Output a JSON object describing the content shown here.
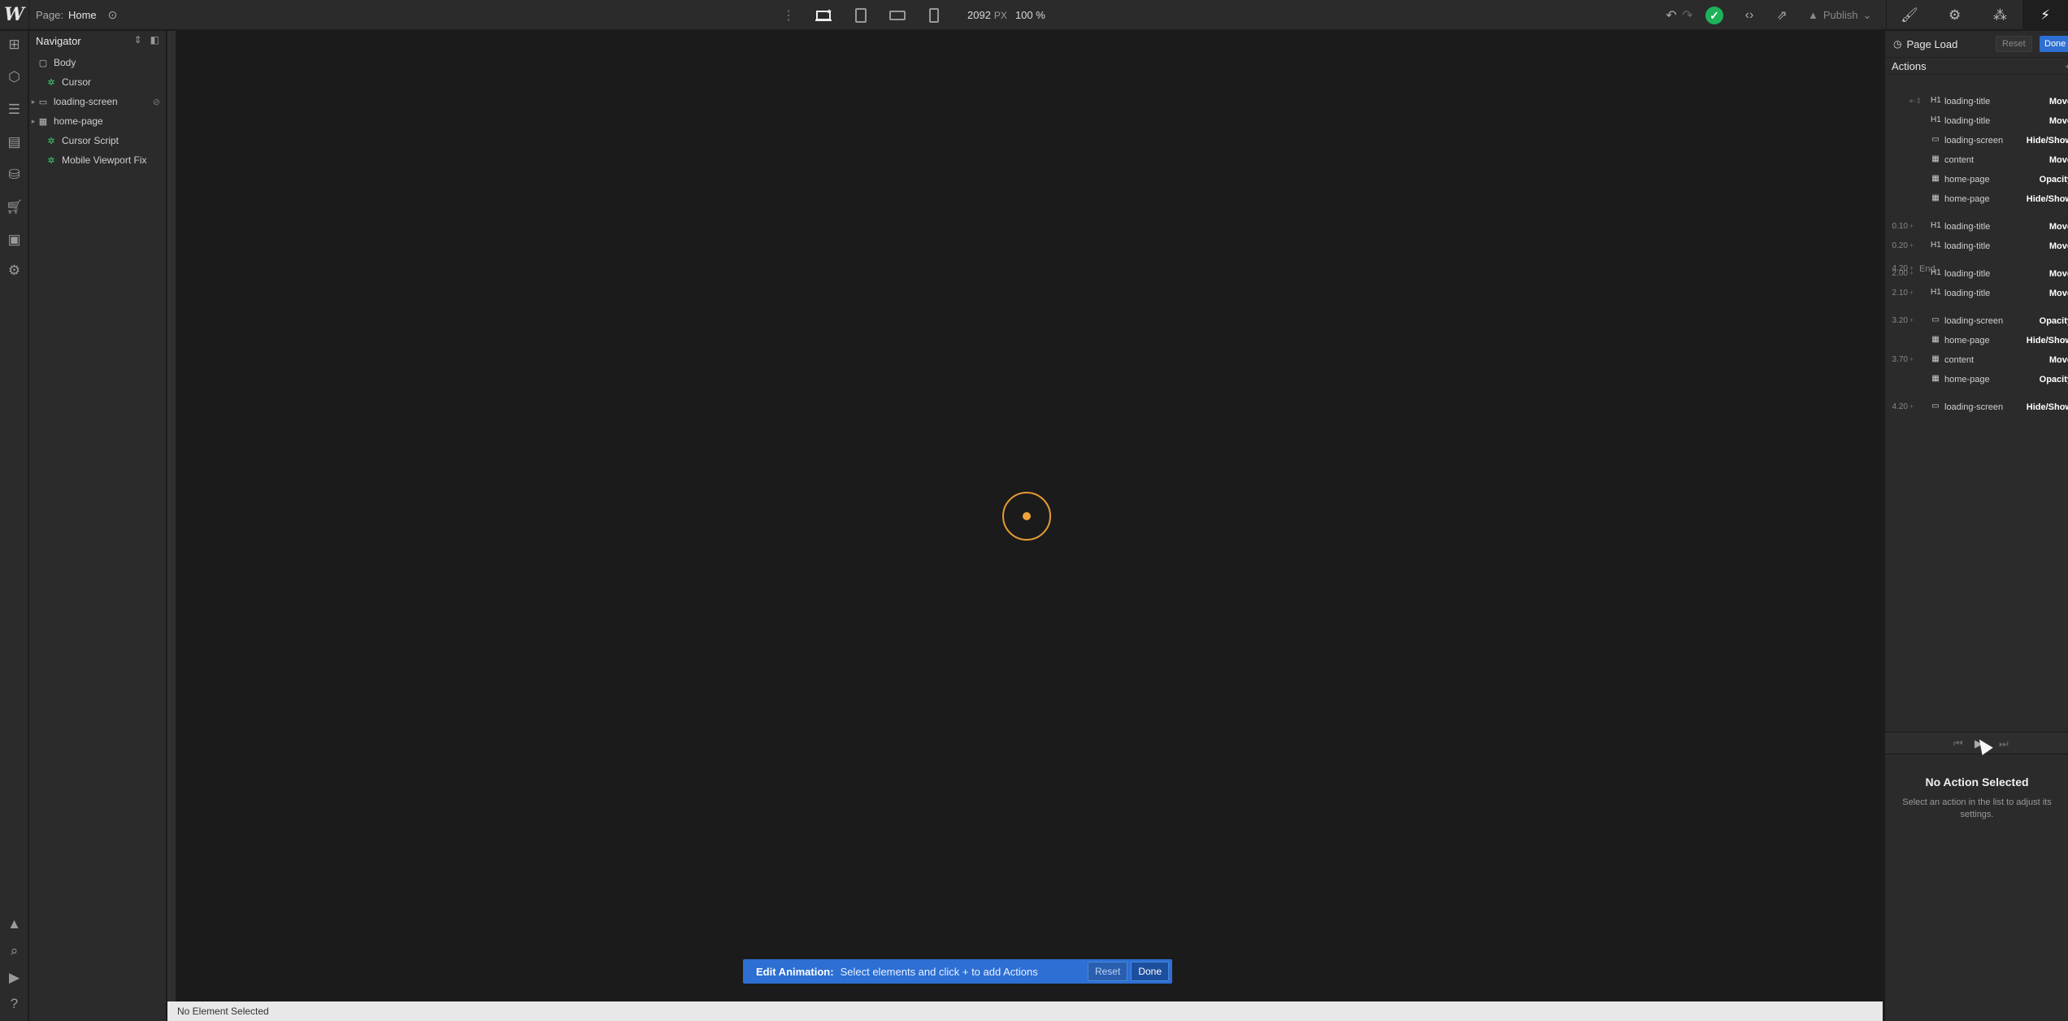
{
  "topbar": {
    "logo": "W",
    "page_label": "Page:",
    "page_name": "Home",
    "width_value": "2092",
    "width_unit": "PX",
    "zoom": "100 %",
    "publish_label": "Publish",
    "breakpoints": [
      "desktop-icon",
      "tablet-icon",
      "mobile-landscape-icon",
      "mobile-portrait-icon"
    ]
  },
  "right_tabs": [
    "style-brush-icon",
    "settings-gear-icon",
    "style-manager-icon",
    "interactions-bolt-icon"
  ],
  "navigator": {
    "title": "Navigator",
    "items": [
      {
        "label": "Body",
        "icon": "box-icon"
      },
      {
        "label": "Cursor",
        "icon": "symbol-icon"
      },
      {
        "label": "loading-screen",
        "icon": "section-icon"
      },
      {
        "label": "home-page",
        "icon": "grid-icon"
      },
      {
        "label": "Cursor Script",
        "icon": "symbol-icon"
      },
      {
        "label": "Mobile Viewport Fix",
        "icon": "symbol-icon"
      }
    ]
  },
  "edit_bar": {
    "title": "Edit Animation:",
    "message": "Select elements and click + to add Actions",
    "reset": "Reset",
    "done": "Done"
  },
  "status": {
    "text": "No Element Selected"
  },
  "panel": {
    "trigger": "Page Load",
    "reset": "Reset",
    "done": "Done",
    "actions_title": "Actions",
    "actions": [
      {
        "time": "",
        "icon": "H1",
        "target": "loading-title",
        "type": "Move"
      },
      {
        "time": "",
        "icon": "H1",
        "target": "loading-title",
        "type": "Move"
      },
      {
        "time": "",
        "icon": "▭",
        "target": "loading-screen",
        "type": "Hide/Show"
      },
      {
        "time": "",
        "icon": "▦",
        "target": "content",
        "type": "Move"
      },
      {
        "time": "",
        "icon": "▦",
        "target": "home-page",
        "type": "Opacity"
      },
      {
        "time": "",
        "icon": "▦",
        "target": "home-page",
        "type": "Hide/Show"
      },
      {
        "time": "0.10",
        "icon": "H1",
        "target": "loading-title",
        "type": "Move"
      },
      {
        "time": "0.20",
        "icon": "H1",
        "target": "loading-title",
        "type": "Move"
      },
      {
        "time": "2.00",
        "icon": "H1",
        "target": "loading-title",
        "type": "Move"
      },
      {
        "time": "2.10",
        "icon": "H1",
        "target": "loading-title",
        "type": "Move"
      },
      {
        "time": "3.20",
        "icon": "▭",
        "target": "loading-screen",
        "type": "Opacity"
      },
      {
        "time": "",
        "icon": "▦",
        "target": "home-page",
        "type": "Hide/Show"
      },
      {
        "time": "3.70",
        "icon": "▦",
        "target": "content",
        "type": "Move"
      },
      {
        "time": "",
        "icon": "▦",
        "target": "home-page",
        "type": "Opacity"
      },
      {
        "time": "4.20",
        "icon": "▭",
        "target": "loading-screen",
        "type": "Hide/Show"
      }
    ],
    "end_time": "4.20",
    "end_label": "End",
    "no_action_title": "No Action Selected",
    "no_action_sub": "Select an action in the list to adjust its settings."
  },
  "colors": {
    "accent": "#2d6fd3",
    "cursor_ring": "#e39a33",
    "success": "#1fb25a",
    "symbol_green": "#3ccf6b"
  }
}
